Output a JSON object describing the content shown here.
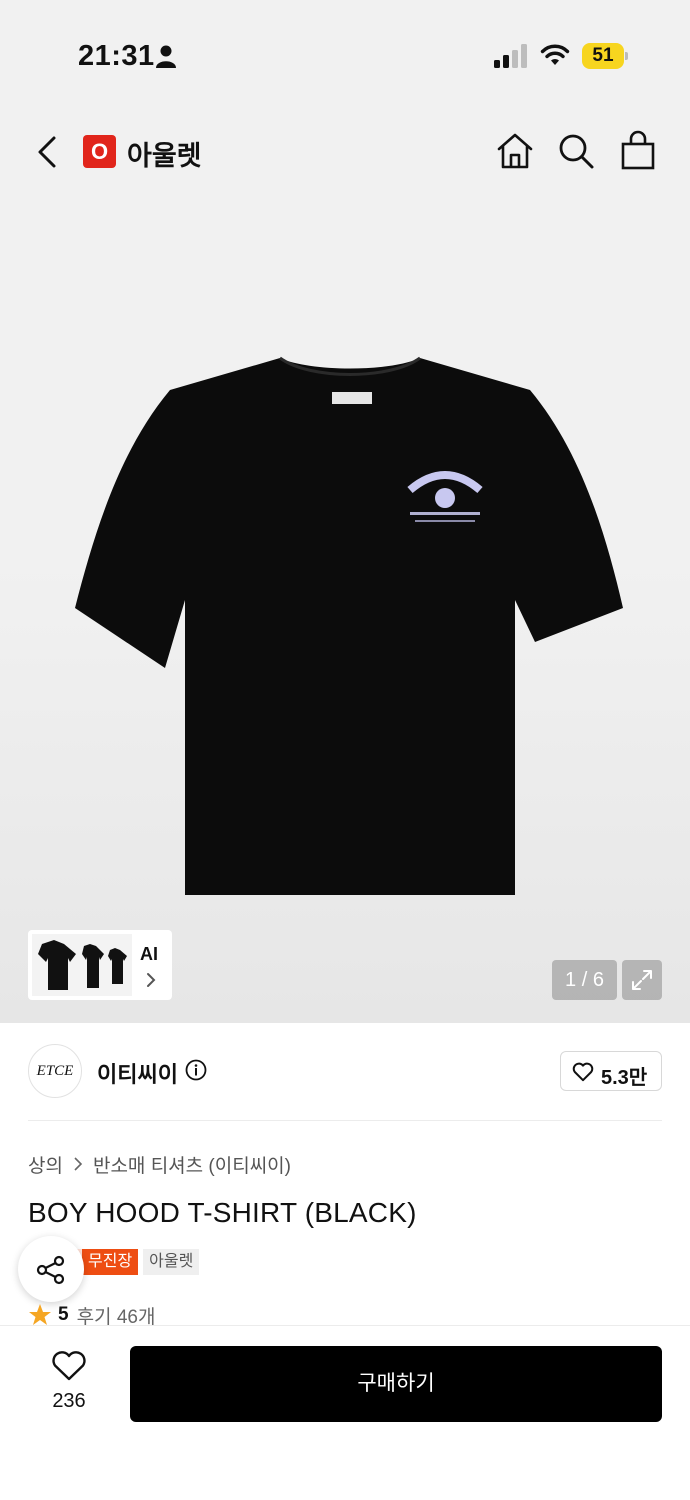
{
  "status_bar": {
    "time": "21:31",
    "battery": "51"
  },
  "header": {
    "brand_logo_letter": "O",
    "brand_name": "아울렛"
  },
  "gallery": {
    "ai_label": "AI",
    "page_counter": "1 / 6"
  },
  "brand": {
    "avatar_text": "ETCE",
    "name": "이티씨이",
    "likes": "5.3만"
  },
  "product": {
    "breadcrumb": [
      "상의",
      "반소매 티셔츠 (이티씨이)"
    ],
    "title": "BOY HOOD T-SHIRT (BLACK)",
    "badges": {
      "free": "무진장",
      "outlet": "아울렛"
    },
    "rating": "5",
    "reviews": "후기 46개"
  },
  "bottom_bar": {
    "wish_count": "236",
    "buy_label": "구매하기"
  },
  "colors": {
    "brand_red": "#e1251b",
    "badge_orange": "#ee4d12",
    "star": "#f5a623",
    "battery": "#f7d51f"
  }
}
